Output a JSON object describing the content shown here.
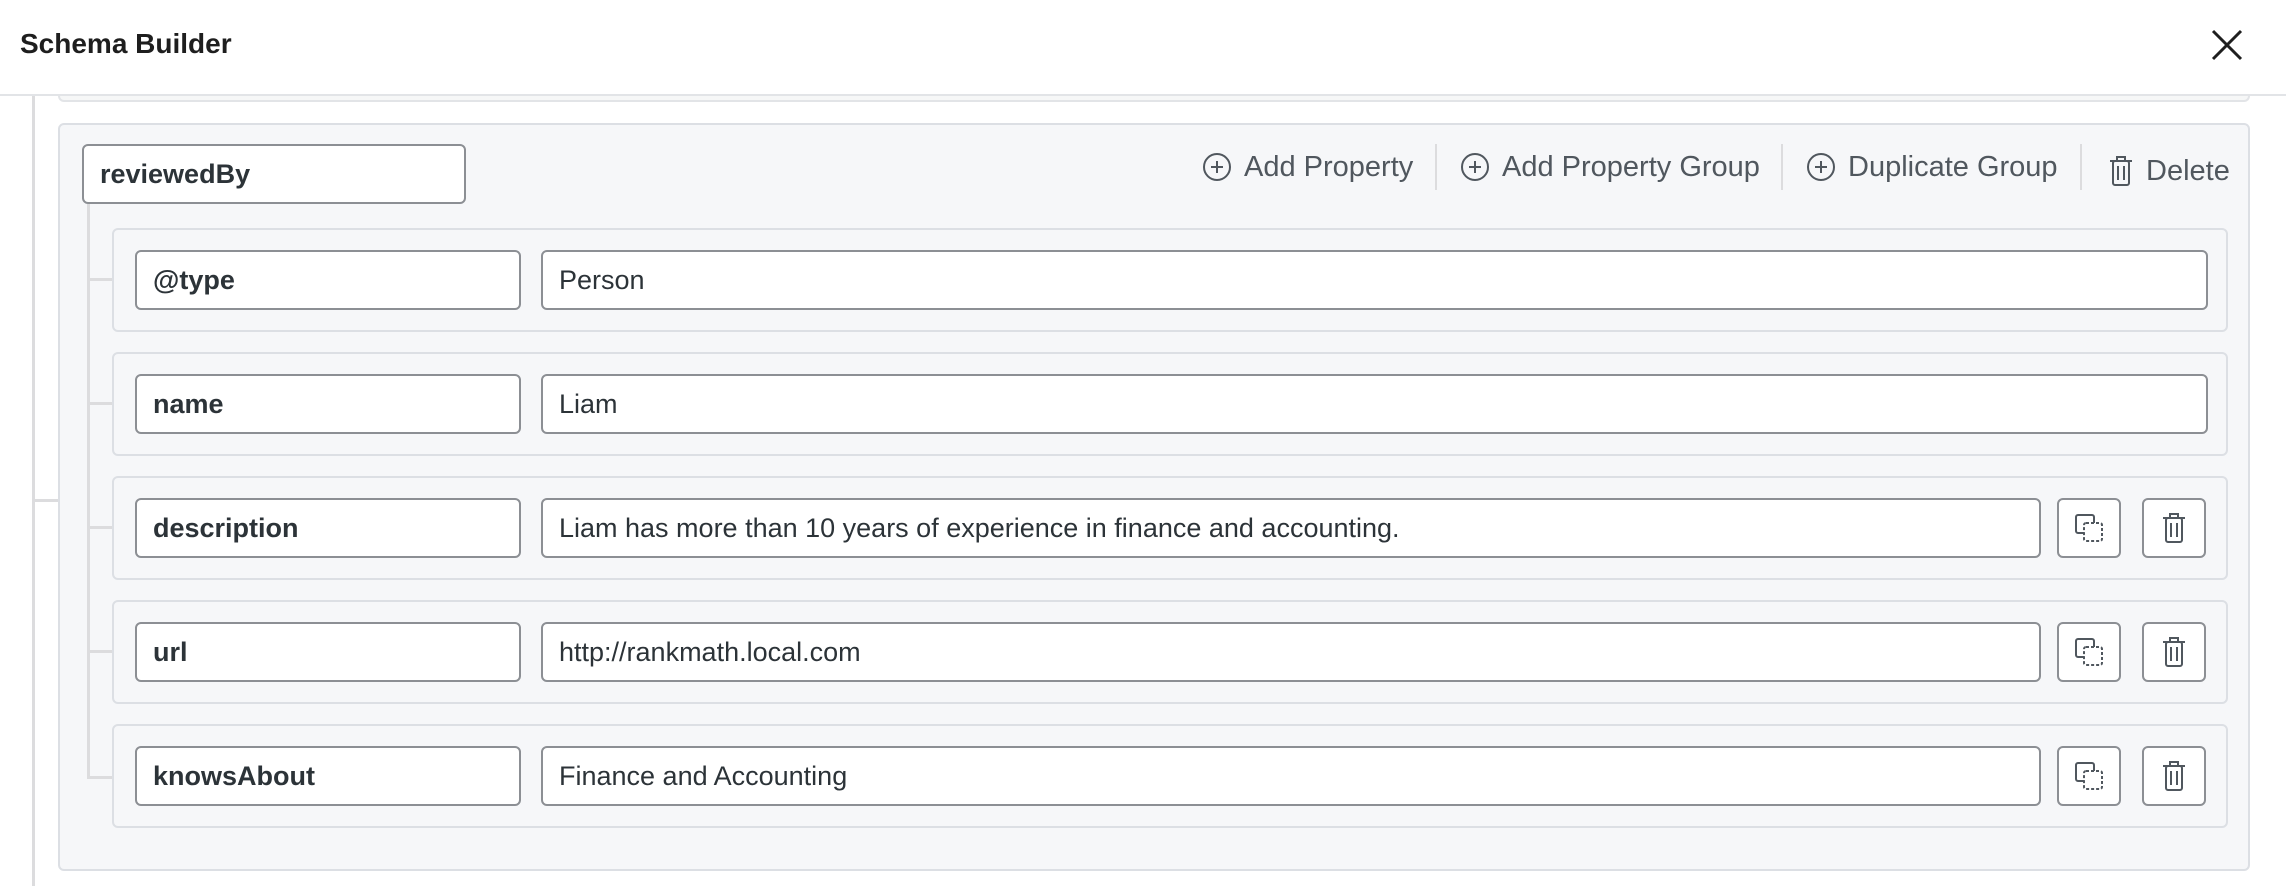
{
  "header": {
    "title": "Schema Builder",
    "close_icon": "close-icon"
  },
  "group": {
    "name": "reviewedBy",
    "toolbar": {
      "add_property": "Add Property",
      "add_property_group": "Add Property Group",
      "duplicate_group": "Duplicate Group",
      "delete": "Delete"
    },
    "properties": [
      {
        "key": "@type",
        "value": "Person",
        "has_actions": false
      },
      {
        "key": "name",
        "value": "Liam",
        "has_actions": false
      },
      {
        "key": "description",
        "value": "Liam has more than 10 years of experience in finance and accounting.",
        "has_actions": true
      },
      {
        "key": "url",
        "value": "http://rankmath.local.com",
        "has_actions": true
      },
      {
        "key": "knowsAbout",
        "value": "Finance and Accounting",
        "has_actions": true
      }
    ]
  },
  "icons": {
    "add": "plus-circle-icon",
    "duplicate": "duplicate-icon",
    "delete": "trash-icon"
  },
  "colors": {
    "text": "#1e1e1e",
    "muted": "#50575e",
    "border": "#8c8f94",
    "panel": "#f6f7f9"
  }
}
